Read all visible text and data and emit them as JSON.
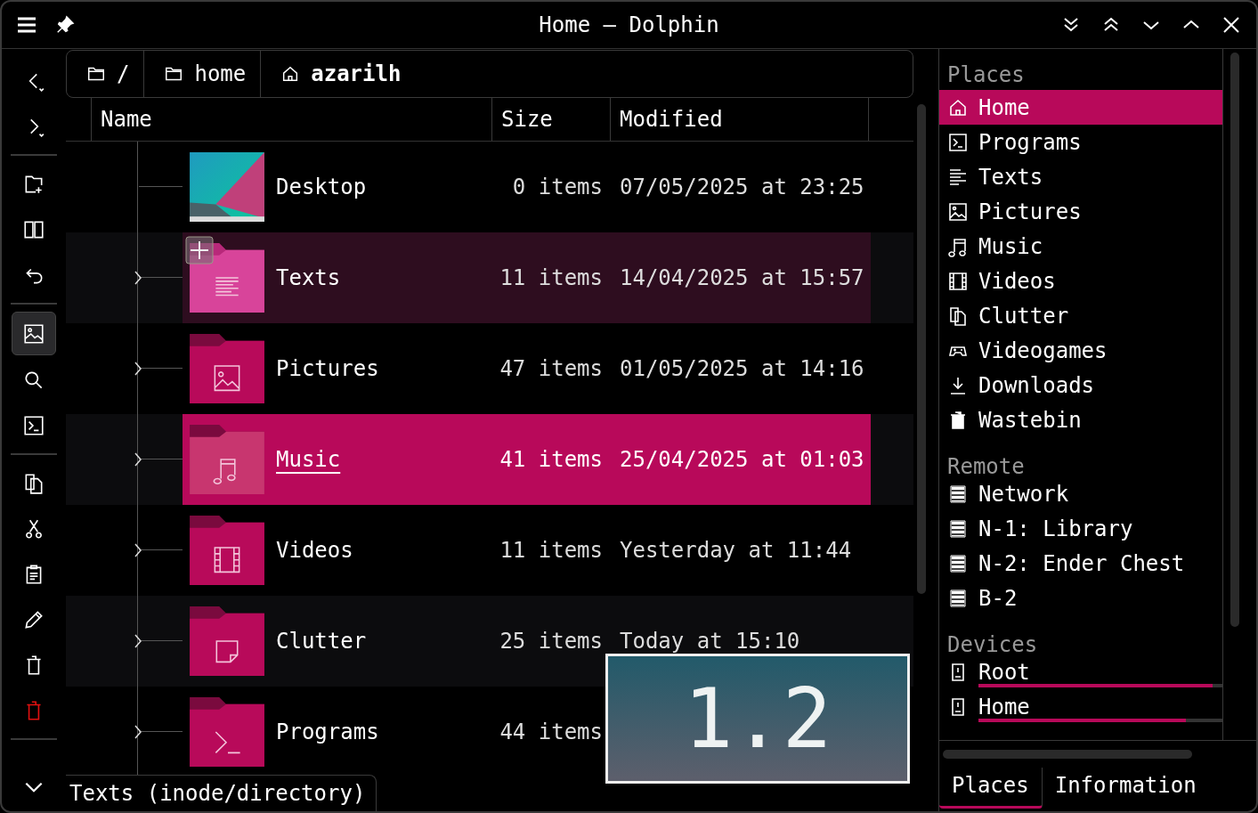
{
  "window": {
    "title": "Home — Dolphin"
  },
  "toolbar": [
    {
      "kind": "back",
      "selected": false
    },
    {
      "kind": "forward",
      "selected": false
    },
    {
      "kind": "sep"
    },
    {
      "kind": "new-folder",
      "selected": false
    },
    {
      "kind": "split",
      "selected": false
    },
    {
      "kind": "undo",
      "selected": false
    },
    {
      "kind": "sep"
    },
    {
      "kind": "preview",
      "selected": true
    },
    {
      "kind": "search",
      "selected": false
    },
    {
      "kind": "terminal",
      "selected": false
    },
    {
      "kind": "sep"
    },
    {
      "kind": "copy",
      "selected": false
    },
    {
      "kind": "cut",
      "selected": false
    },
    {
      "kind": "paste",
      "selected": false
    },
    {
      "kind": "rename",
      "selected": false
    },
    {
      "kind": "trash",
      "selected": false
    },
    {
      "kind": "delete",
      "selected": false
    },
    {
      "kind": "sep"
    }
  ],
  "breadcrumb": [
    {
      "label": "/",
      "kind": "folder",
      "current": false
    },
    {
      "label": "home",
      "kind": "folder",
      "current": false
    },
    {
      "label": "azarilh",
      "kind": "home",
      "current": true
    }
  ],
  "columns": [
    "Name",
    "Size",
    "Modified"
  ],
  "rows": [
    {
      "name": "Desktop",
      "kind": "desktop",
      "size": "0 items",
      "modified": "07/05/2025 at 23:25",
      "expandable": false,
      "hovered": false,
      "selected": false,
      "focused": false
    },
    {
      "name": "Texts",
      "kind": "texts",
      "size": "11 items",
      "modified": "14/04/2025 at 15:57",
      "expandable": true,
      "hovered": true,
      "selected": false,
      "focused": false
    },
    {
      "name": "Pictures",
      "kind": "pictures",
      "size": "47 items",
      "modified": "01/05/2025 at 14:16",
      "expandable": true,
      "hovered": false,
      "selected": false,
      "focused": false
    },
    {
      "name": "Music",
      "kind": "music",
      "size": "41 items",
      "modified": "25/04/2025 at 01:03",
      "expandable": true,
      "hovered": false,
      "selected": true,
      "focused": true
    },
    {
      "name": "Videos",
      "kind": "videos",
      "size": "11 items",
      "modified": "Yesterday at 11:44",
      "expandable": true,
      "hovered": false,
      "selected": false,
      "focused": false
    },
    {
      "name": "Clutter",
      "kind": "clutter",
      "size": "25 items",
      "modified": "Today at 15:10",
      "expandable": true,
      "hovered": false,
      "selected": false,
      "focused": false
    },
    {
      "name": "Programs",
      "kind": "programs",
      "size": "44 items",
      "expandable": true,
      "hovered": false,
      "selected": false,
      "focused": false
    }
  ],
  "status": "Texts (inode/directory)",
  "overlay": {
    "text": "1.2"
  },
  "places": [
    {
      "heading": "Places",
      "items": [
        {
          "label": "Home",
          "kind": "home",
          "selected": true
        },
        {
          "label": "Programs",
          "kind": "terminal",
          "selected": false
        },
        {
          "label": "Texts",
          "kind": "texts",
          "selected": false
        },
        {
          "label": "Pictures",
          "kind": "pictures",
          "selected": false
        },
        {
          "label": "Music",
          "kind": "music",
          "selected": false
        },
        {
          "label": "Videos",
          "kind": "videos",
          "selected": false
        },
        {
          "label": "Clutter",
          "kind": "clutter",
          "selected": false
        },
        {
          "label": "Videogames",
          "kind": "gamepad",
          "selected": false
        },
        {
          "label": "Downloads",
          "kind": "downloads",
          "selected": false
        },
        {
          "label": "Wastebin",
          "kind": "wastebin",
          "selected": false
        }
      ]
    },
    {
      "heading": "Remote",
      "items": [
        {
          "label": "Network",
          "kind": "network",
          "selected": false
        },
        {
          "label": "N-1: Library",
          "kind": "network",
          "selected": false
        },
        {
          "label": "N-2: Ender Chest",
          "kind": "network",
          "selected": false
        },
        {
          "label": "B-2",
          "kind": "network",
          "selected": false
        }
      ]
    },
    {
      "heading": "Devices",
      "items": [
        {
          "label": "Root",
          "kind": "drive",
          "selected": false,
          "level": 0.96
        },
        {
          "label": "Home",
          "kind": "drive",
          "selected": false,
          "level": 0.85
        }
      ]
    }
  ],
  "panel_tabs": [
    {
      "label": "Places",
      "selected": true
    },
    {
      "label": "Information",
      "selected": false
    }
  ]
}
